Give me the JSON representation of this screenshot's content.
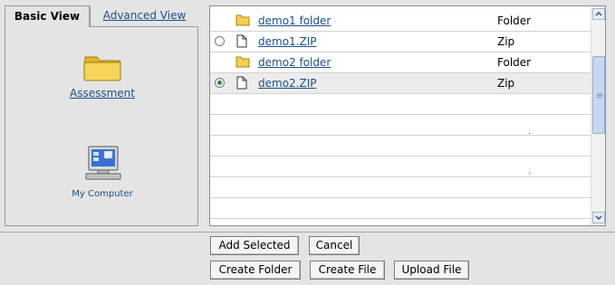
{
  "tabs": {
    "basic": "Basic View",
    "advanced": "Advanced View"
  },
  "locations": {
    "assessment": "Assessment",
    "computer": "My Computer"
  },
  "files": [
    {
      "name": "demo1 folder",
      "type": "Folder",
      "kind": "folder",
      "radio": false,
      "selected": false
    },
    {
      "name": "demo1.ZIP",
      "type": "Zip",
      "kind": "file",
      "radio": true,
      "selected": false
    },
    {
      "name": "demo2 folder",
      "type": "Folder",
      "kind": "folder",
      "radio": false,
      "selected": false
    },
    {
      "name": "demo2.ZIP",
      "type": "Zip",
      "kind": "file",
      "radio": true,
      "selected": true
    }
  ],
  "buttons": {
    "add_selected": "Add Selected",
    "cancel": "Cancel",
    "create_folder": "Create Folder",
    "create_file": "Create File",
    "upload_file": "Upload File"
  },
  "colors": {
    "link": "#1c4e8a",
    "folder": "#f3cf4e",
    "radio_checked": "#2f8a2f"
  }
}
